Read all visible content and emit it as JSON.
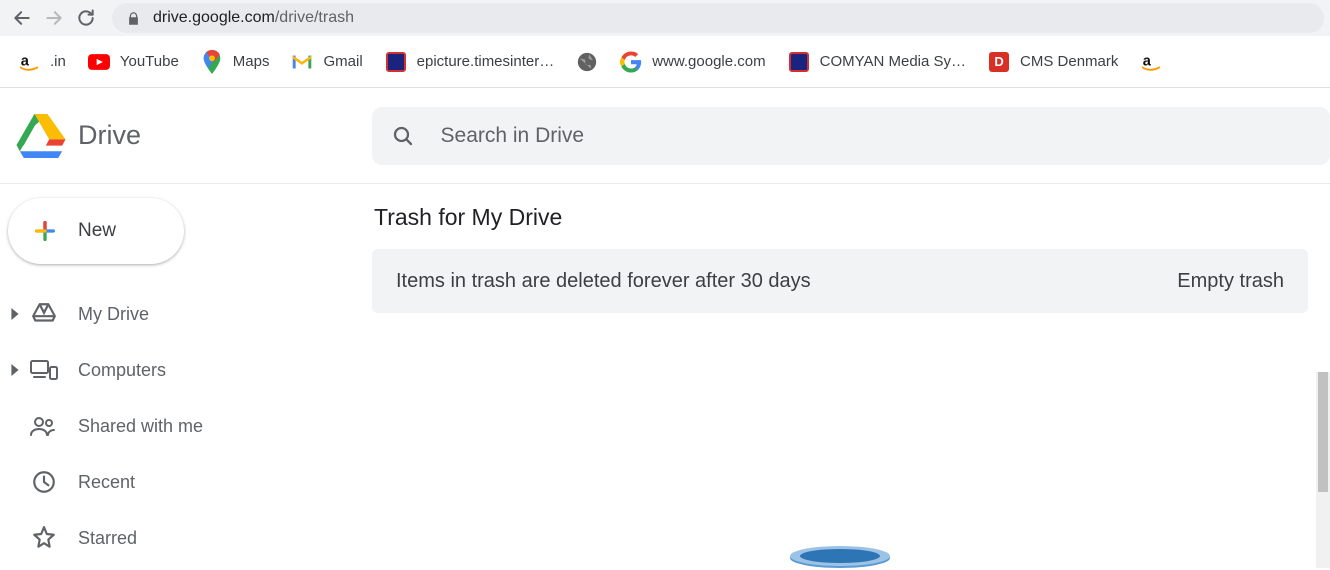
{
  "browser": {
    "url_host": "drive.google.com",
    "url_path": "/drive/trash",
    "bookmarks": [
      {
        "label": ".in",
        "icon": "amazon"
      },
      {
        "label": "YouTube",
        "icon": "youtube"
      },
      {
        "label": "Maps",
        "icon": "gmaps"
      },
      {
        "label": "Gmail",
        "icon": "gmail"
      },
      {
        "label": "epicture.timesinter…",
        "icon": "redsq"
      },
      {
        "label": "",
        "icon": "globe"
      },
      {
        "label": "www.google.com",
        "icon": "google-g"
      },
      {
        "label": "COMYAN Media Sy…",
        "icon": "redsq"
      },
      {
        "label": "CMS Denmark",
        "icon": "redD"
      },
      {
        "label": "",
        "icon": "amazon"
      }
    ]
  },
  "brand": {
    "name": "Drive"
  },
  "search": {
    "placeholder": "Search in Drive"
  },
  "new_button": {
    "label": "New"
  },
  "sidebar": {
    "items": [
      {
        "label": "My Drive",
        "has_caret": true,
        "icon": "mydrive"
      },
      {
        "label": "Computers",
        "has_caret": true,
        "icon": "computers"
      },
      {
        "label": "Shared with me",
        "has_caret": false,
        "icon": "shared"
      },
      {
        "label": "Recent",
        "has_caret": false,
        "icon": "recent"
      },
      {
        "label": "Starred",
        "has_caret": false,
        "icon": "star"
      }
    ]
  },
  "page": {
    "title": "Trash for My Drive",
    "notice_text": "Items in trash are deleted forever after 30 days",
    "notice_action": "Empty trash"
  }
}
